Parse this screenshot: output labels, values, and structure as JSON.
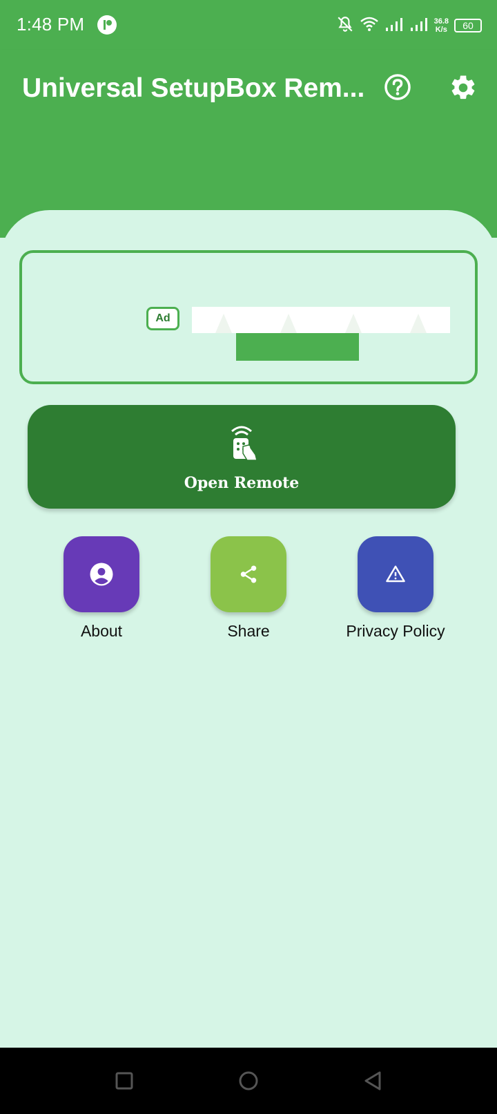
{
  "status_bar": {
    "time": "1:48 PM",
    "speed_value": "36.8",
    "speed_unit": "K/s",
    "battery": "60"
  },
  "app_bar": {
    "title": "Universal SetupBox Rem...",
    "help_icon": "help-circle-icon",
    "settings_icon": "gear-icon"
  },
  "ad": {
    "badge": "Ad"
  },
  "main": {
    "open_remote_label": "Open Remote",
    "actions": [
      {
        "label": "About",
        "icon": "person-circle-icon",
        "color": "#673ab7"
      },
      {
        "label": "Share",
        "icon": "share-icon",
        "color": "#8bc34a"
      },
      {
        "label": "Privacy Policy",
        "icon": "warning-icon",
        "color": "#3f51b5"
      }
    ]
  },
  "colors": {
    "primary": "#4caf50",
    "dark_primary": "#2e7d32",
    "background": "#d6f5e6"
  }
}
